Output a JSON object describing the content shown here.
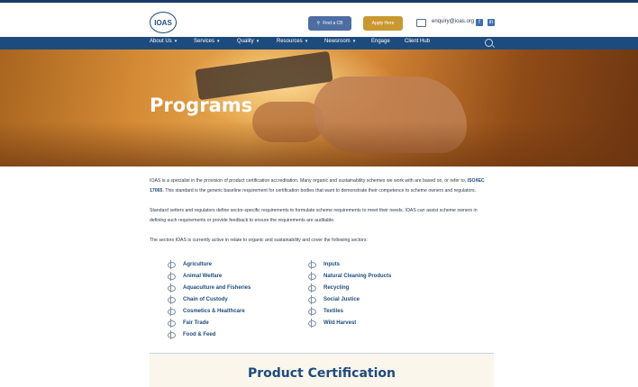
{
  "header": {
    "logo_text": "IOAS",
    "find_cb_label": "Find a CB",
    "apply_label": "Apply Here",
    "email": "enquiry@ioas.org",
    "social": [
      "facebook-icon",
      "linkedin-icon"
    ]
  },
  "nav": {
    "items": [
      {
        "label": "About Us",
        "dropdown": true
      },
      {
        "label": "Services",
        "dropdown": true
      },
      {
        "label": "Quality",
        "dropdown": true
      },
      {
        "label": "Resources",
        "dropdown": true
      },
      {
        "label": "Newsroom",
        "dropdown": true
      },
      {
        "label": "Engage",
        "dropdown": false
      },
      {
        "label": "Client Hub",
        "dropdown": false
      }
    ]
  },
  "hero": {
    "title": "Programs"
  },
  "content": {
    "p1_a": "IOAS is a specialist in the provision of product certification accreditation. Many organic and sustainability schemes we work with are based on, or refer to,",
    "p1_bold": "ISO/IEC 17065",
    "p1_b": ". This standard is the generic baseline requirement for certification bodies that want to demonstrate their competence to scheme owners and regulators.",
    "p2": "Standard setters and regulators define sector-specific requirements to formulate scheme requirements to meet their needs. IOAS can assist scheme owners in defining such requirements or provide feedback to ensure the requirements are auditable.",
    "p3": "The sectors IOAS is currently active in relate to organic and sustainability and cover the following sectors:"
  },
  "sectors": {
    "left": [
      "Agriculture",
      "Animal Welfare",
      "Aquaculture and Fisheries",
      "Chain of Custody",
      "Cosmetics & Healthcare",
      "Fair Trade",
      "Food & Feed"
    ],
    "right": [
      "Inputs",
      "Natural Cleaning Products",
      "Recycling",
      "Social Justice",
      "Textiles",
      "Wild Harvest"
    ]
  },
  "section": {
    "title": "Product Certification"
  },
  "colors": {
    "brand_blue": "#1e4b7d",
    "apply_gold": "#c9982f",
    "find_cb_blue": "#4d6ea3"
  }
}
